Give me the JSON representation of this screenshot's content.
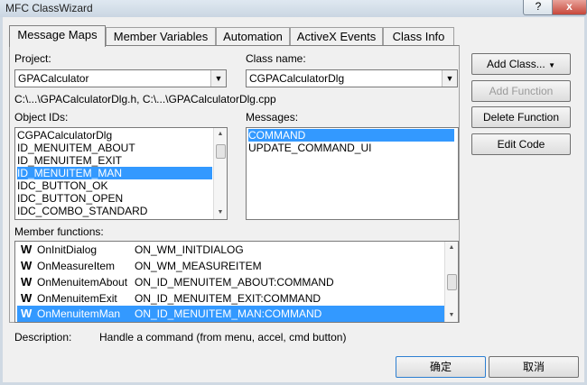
{
  "window": {
    "title": "MFC ClassWizard",
    "help_glyph": "?",
    "close_glyph": "x"
  },
  "tabs": [
    {
      "label": "Message Maps",
      "active": true
    },
    {
      "label": "Member Variables"
    },
    {
      "label": "Automation"
    },
    {
      "label": "ActiveX Events"
    },
    {
      "label": "Class Info"
    }
  ],
  "project": {
    "label": "Project:",
    "value": "GPACalculator"
  },
  "class_name": {
    "label": "Class name:",
    "value": "CGPACalculatorDlg"
  },
  "file_path": "C:\\...\\GPACalculatorDlg.h, C:\\...\\GPACalculatorDlg.cpp",
  "object_ids": {
    "label": "Object IDs:",
    "items": [
      "CGPACalculatorDlg",
      "ID_MENUITEM_ABOUT",
      "ID_MENUITEM_EXIT",
      "ID_MENUITEM_MAN",
      "IDC_BUTTON_OK",
      "IDC_BUTTON_OPEN",
      "IDC_COMBO_STANDARD"
    ],
    "selected_index": 3
  },
  "messages": {
    "label": "Messages:",
    "items": [
      "COMMAND",
      "UPDATE_COMMAND_UI"
    ],
    "selected_index": 0
  },
  "member_functions": {
    "label": "Member functions:",
    "icon_glyph": "W",
    "rows": [
      {
        "func": "OnInitDialog",
        "msg": "ON_WM_INITDIALOG"
      },
      {
        "func": "OnMeasureItem",
        "msg": "ON_WM_MEASUREITEM"
      },
      {
        "func": "OnMenuitemAbout",
        "msg": "ON_ID_MENUITEM_ABOUT:COMMAND"
      },
      {
        "func": "OnMenuitemExit",
        "msg": "ON_ID_MENUITEM_EXIT:COMMAND"
      },
      {
        "func": "OnMenuitemMan",
        "msg": "ON_ID_MENUITEM_MAN:COMMAND"
      }
    ],
    "selected_index": 4
  },
  "description": {
    "label": "Description:",
    "text": "Handle a command (from menu, accel, cmd button)"
  },
  "buttons": {
    "add_class": "Add Class...",
    "add_class_arrow": "▼",
    "add_function": "Add Function",
    "delete_function": "Delete Function",
    "edit_code": "Edit Code",
    "ok": "确定",
    "cancel": "取消"
  },
  "scroll_glyphs": {
    "up": "▲",
    "down": "▼",
    "combo": "▼"
  }
}
